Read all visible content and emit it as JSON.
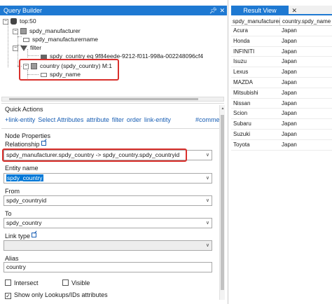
{
  "query_builder": {
    "title": "Query Builder",
    "pin_icon": "pin-icon",
    "close_icon": "close-icon",
    "tree": {
      "root": "top:50",
      "entity": "spdy_manufacturer",
      "attribute": "spdy_manufacturername",
      "filter": "filter",
      "condition": "spdy_country eq 9f84eede-9212-f011-998a-002248096cf4",
      "link_entity": "country (spdy_country) M:1",
      "link_attribute": "spdy_name"
    },
    "quick_actions": {
      "label": "Quick Actions",
      "links": [
        "+link-entity",
        "Select Attributes",
        "attribute",
        "filter",
        "order",
        "link-entity"
      ],
      "comment": "#comment"
    },
    "node_properties": {
      "label": "Node Properties",
      "relationship_label": "Relationship",
      "relationship_value": "spdy_manufacturer.spdy_country -> spdy_country.spdy_countryid",
      "entity_name_label": "Entity name",
      "entity_name_value": "spdy_country",
      "from_label": "From",
      "from_value": "spdy_countryid",
      "to_label": "To",
      "to_value": "spdy_country",
      "link_type_label": "Link type",
      "link_type_value": "",
      "alias_label": "Alias",
      "alias_value": "country",
      "intersect_label": "Intersect",
      "visible_label": "Visible",
      "show_lookups_label": "Show only Lookups/IDs attributes",
      "intersect_checked": false,
      "visible_checked": false,
      "show_lookups_checked": true
    }
  },
  "result_view": {
    "tab_label": "Result View",
    "columns": [
      "spdy_manufacturer",
      "country.spdy_name"
    ],
    "rows": [
      [
        "Acura",
        "Japan"
      ],
      [
        "Honda",
        "Japan"
      ],
      [
        "INFINITI",
        "Japan"
      ],
      [
        "Isuzu",
        "Japan"
      ],
      [
        "Lexus",
        "Japan"
      ],
      [
        "MAZDA",
        "Japan"
      ],
      [
        "Mitsubishi",
        "Japan"
      ],
      [
        "Nissan",
        "Japan"
      ],
      [
        "Scion",
        "Japan"
      ],
      [
        "Subaru",
        "Japan"
      ],
      [
        "Suzuki",
        "Japan"
      ],
      [
        "Toyota",
        "Japan"
      ]
    ]
  },
  "colors": {
    "accent": "#1e79d2",
    "highlight_border": "#d9302c",
    "link": "#1a5fb4"
  }
}
